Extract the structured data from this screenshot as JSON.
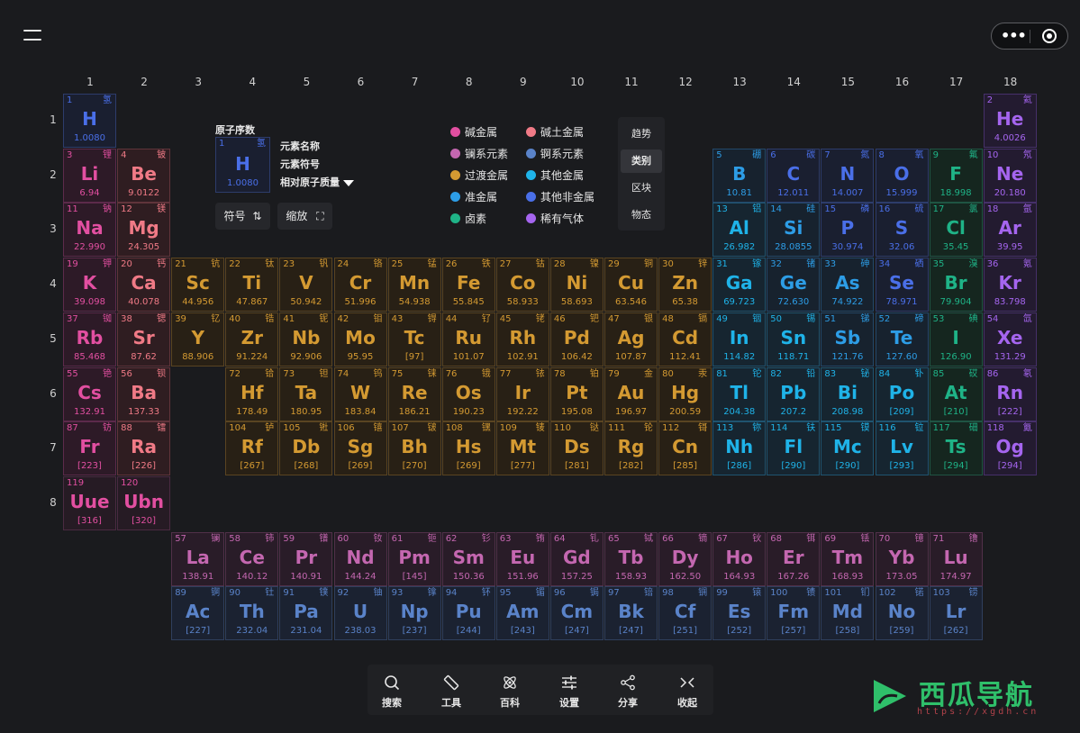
{
  "group_numbers": [
    "1",
    "2",
    "3",
    "4",
    "5",
    "6",
    "7",
    "8",
    "9",
    "10",
    "11",
    "12",
    "13",
    "14",
    "15",
    "16",
    "17",
    "18"
  ],
  "period_numbers": [
    "1",
    "2",
    "3",
    "4",
    "5",
    "6",
    "7",
    "8"
  ],
  "legend": {
    "atomic_number_label": "原子序数",
    "name_label": "元素名称",
    "symbol_label": "元素符号",
    "mass_label": "相对原子质量",
    "sample": {
      "n": "1",
      "cn": "氢",
      "s": "H",
      "m": "1.0080"
    }
  },
  "buttons": {
    "symbol_sort": "符号",
    "zoom": "缩放"
  },
  "categories": [
    {
      "key": "alkali",
      "label": "碱金属",
      "color": "#e24fa1"
    },
    {
      "key": "alkaline",
      "label": "碱土金属",
      "color": "#f07a86"
    },
    {
      "key": "lanth",
      "label": "镧系元素",
      "color": "#c467b0"
    },
    {
      "key": "actin",
      "label": "锕系元素",
      "color": "#5a83c9"
    },
    {
      "key": "trans",
      "label": "过渡金属",
      "color": "#d49a32"
    },
    {
      "key": "post",
      "label": "其他金属",
      "color": "#1fb3e8"
    },
    {
      "key": "metalloid",
      "label": "准金属",
      "color": "#2d9de6"
    },
    {
      "key": "nonmetal",
      "label": "其他非金属",
      "color": "#4a6fe8"
    },
    {
      "key": "halogen",
      "label": "卤素",
      "color": "#1fb387"
    },
    {
      "key": "noble",
      "label": "稀有气体",
      "color": "#a565ef"
    }
  ],
  "view_modes": [
    {
      "label": "趋势",
      "active": false
    },
    {
      "label": "类别",
      "active": true
    },
    {
      "label": "区块",
      "active": false
    },
    {
      "label": "物态",
      "active": false
    }
  ],
  "bottom_bar": [
    {
      "label": "搜索",
      "icon": "search-icon"
    },
    {
      "label": "工具",
      "icon": "ruler-icon"
    },
    {
      "label": "百科",
      "icon": "atom-icon"
    },
    {
      "label": "设置",
      "icon": "sliders-icon"
    },
    {
      "label": "分享",
      "icon": "share-icon"
    },
    {
      "label": "收起",
      "icon": "collapse-icon"
    }
  ],
  "logo": {
    "text": "西瓜导航",
    "url": "https://xgdh.cn"
  },
  "elements": [
    {
      "n": "1",
      "s": "H",
      "cn": "氢",
      "m": "1.0080",
      "c": "nonmetal",
      "col": 1,
      "row": 1
    },
    {
      "n": "2",
      "s": "He",
      "cn": "氦",
      "m": "4.0026",
      "c": "noble",
      "col": 18,
      "row": 1
    },
    {
      "n": "3",
      "s": "Li",
      "cn": "锂",
      "m": "6.94",
      "c": "alkali",
      "col": 1,
      "row": 2
    },
    {
      "n": "4",
      "s": "Be",
      "cn": "铍",
      "m": "9.0122",
      "c": "alkaline",
      "col": 2,
      "row": 2
    },
    {
      "n": "5",
      "s": "B",
      "cn": "硼",
      "m": "10.81",
      "c": "metalloid",
      "col": 13,
      "row": 2
    },
    {
      "n": "6",
      "s": "C",
      "cn": "碳",
      "m": "12.011",
      "c": "nonmetal",
      "col": 14,
      "row": 2
    },
    {
      "n": "7",
      "s": "N",
      "cn": "氮",
      "m": "14.007",
      "c": "nonmetal",
      "col": 15,
      "row": 2
    },
    {
      "n": "8",
      "s": "O",
      "cn": "氧",
      "m": "15.999",
      "c": "nonmetal",
      "col": 16,
      "row": 2
    },
    {
      "n": "9",
      "s": "F",
      "cn": "氟",
      "m": "18.998",
      "c": "halogen",
      "col": 17,
      "row": 2
    },
    {
      "n": "10",
      "s": "Ne",
      "cn": "氖",
      "m": "20.180",
      "c": "noble",
      "col": 18,
      "row": 2
    },
    {
      "n": "11",
      "s": "Na",
      "cn": "钠",
      "m": "22.990",
      "c": "alkali",
      "col": 1,
      "row": 3
    },
    {
      "n": "12",
      "s": "Mg",
      "cn": "镁",
      "m": "24.305",
      "c": "alkaline",
      "col": 2,
      "row": 3
    },
    {
      "n": "13",
      "s": "Al",
      "cn": "铝",
      "m": "26.982",
      "c": "post",
      "col": 13,
      "row": 3
    },
    {
      "n": "14",
      "s": "Si",
      "cn": "硅",
      "m": "28.0855",
      "c": "metalloid",
      "col": 14,
      "row": 3
    },
    {
      "n": "15",
      "s": "P",
      "cn": "磷",
      "m": "30.974",
      "c": "nonmetal",
      "col": 15,
      "row": 3
    },
    {
      "n": "16",
      "s": "S",
      "cn": "硫",
      "m": "32.06",
      "c": "nonmetal",
      "col": 16,
      "row": 3
    },
    {
      "n": "17",
      "s": "Cl",
      "cn": "氯",
      "m": "35.45",
      "c": "halogen",
      "col": 17,
      "row": 3
    },
    {
      "n": "18",
      "s": "Ar",
      "cn": "氩",
      "m": "39.95",
      "c": "noble",
      "col": 18,
      "row": 3
    },
    {
      "n": "19",
      "s": "K",
      "cn": "钾",
      "m": "39.098",
      "c": "alkali",
      "col": 1,
      "row": 4
    },
    {
      "n": "20",
      "s": "Ca",
      "cn": "钙",
      "m": "40.078",
      "c": "alkaline",
      "col": 2,
      "row": 4
    },
    {
      "n": "21",
      "s": "Sc",
      "cn": "钪",
      "m": "44.956",
      "c": "trans",
      "col": 3,
      "row": 4
    },
    {
      "n": "22",
      "s": "Ti",
      "cn": "钛",
      "m": "47.867",
      "c": "trans",
      "col": 4,
      "row": 4
    },
    {
      "n": "23",
      "s": "V",
      "cn": "钒",
      "m": "50.942",
      "c": "trans",
      "col": 5,
      "row": 4
    },
    {
      "n": "24",
      "s": "Cr",
      "cn": "铬",
      "m": "51.996",
      "c": "trans",
      "col": 6,
      "row": 4
    },
    {
      "n": "25",
      "s": "Mn",
      "cn": "锰",
      "m": "54.938",
      "c": "trans",
      "col": 7,
      "row": 4
    },
    {
      "n": "26",
      "s": "Fe",
      "cn": "铁",
      "m": "55.845",
      "c": "trans",
      "col": 8,
      "row": 4
    },
    {
      "n": "27",
      "s": "Co",
      "cn": "钴",
      "m": "58.933",
      "c": "trans",
      "col": 9,
      "row": 4
    },
    {
      "n": "28",
      "s": "Ni",
      "cn": "镍",
      "m": "58.693",
      "c": "trans",
      "col": 10,
      "row": 4
    },
    {
      "n": "29",
      "s": "Cu",
      "cn": "铜",
      "m": "63.546",
      "c": "trans",
      "col": 11,
      "row": 4
    },
    {
      "n": "30",
      "s": "Zn",
      "cn": "锌",
      "m": "65.38",
      "c": "trans",
      "col": 12,
      "row": 4
    },
    {
      "n": "31",
      "s": "Ga",
      "cn": "镓",
      "m": "69.723",
      "c": "post",
      "col": 13,
      "row": 4
    },
    {
      "n": "32",
      "s": "Ge",
      "cn": "锗",
      "m": "72.630",
      "c": "metalloid",
      "col": 14,
      "row": 4
    },
    {
      "n": "33",
      "s": "As",
      "cn": "砷",
      "m": "74.922",
      "c": "metalloid",
      "col": 15,
      "row": 4
    },
    {
      "n": "34",
      "s": "Se",
      "cn": "硒",
      "m": "78.971",
      "c": "nonmetal",
      "col": 16,
      "row": 4
    },
    {
      "n": "35",
      "s": "Br",
      "cn": "溴",
      "m": "79.904",
      "c": "halogen",
      "col": 17,
      "row": 4
    },
    {
      "n": "36",
      "s": "Kr",
      "cn": "氪",
      "m": "83.798",
      "c": "noble",
      "col": 18,
      "row": 4
    },
    {
      "n": "37",
      "s": "Rb",
      "cn": "铷",
      "m": "85.468",
      "c": "alkali",
      "col": 1,
      "row": 5
    },
    {
      "n": "38",
      "s": "Sr",
      "cn": "锶",
      "m": "87.62",
      "c": "alkaline",
      "col": 2,
      "row": 5
    },
    {
      "n": "39",
      "s": "Y",
      "cn": "钇",
      "m": "88.906",
      "c": "trans",
      "col": 3,
      "row": 5
    },
    {
      "n": "40",
      "s": "Zr",
      "cn": "锆",
      "m": "91.224",
      "c": "trans",
      "col": 4,
      "row": 5
    },
    {
      "n": "41",
      "s": "Nb",
      "cn": "铌",
      "m": "92.906",
      "c": "trans",
      "col": 5,
      "row": 5
    },
    {
      "n": "42",
      "s": "Mo",
      "cn": "钼",
      "m": "95.95",
      "c": "trans",
      "col": 6,
      "row": 5
    },
    {
      "n": "43",
      "s": "Tc",
      "cn": "锝",
      "m": "[97]",
      "c": "trans",
      "col": 7,
      "row": 5
    },
    {
      "n": "44",
      "s": "Ru",
      "cn": "钌",
      "m": "101.07",
      "c": "trans",
      "col": 8,
      "row": 5
    },
    {
      "n": "45",
      "s": "Rh",
      "cn": "铑",
      "m": "102.91",
      "c": "trans",
      "col": 9,
      "row": 5
    },
    {
      "n": "46",
      "s": "Pd",
      "cn": "钯",
      "m": "106.42",
      "c": "trans",
      "col": 10,
      "row": 5
    },
    {
      "n": "47",
      "s": "Ag",
      "cn": "银",
      "m": "107.87",
      "c": "trans",
      "col": 11,
      "row": 5
    },
    {
      "n": "48",
      "s": "Cd",
      "cn": "镉",
      "m": "112.41",
      "c": "trans",
      "col": 12,
      "row": 5
    },
    {
      "n": "49",
      "s": "In",
      "cn": "铟",
      "m": "114.82",
      "c": "post",
      "col": 13,
      "row": 5
    },
    {
      "n": "50",
      "s": "Sn",
      "cn": "锡",
      "m": "118.71",
      "c": "post",
      "col": 14,
      "row": 5
    },
    {
      "n": "51",
      "s": "Sb",
      "cn": "锑",
      "m": "121.76",
      "c": "metalloid",
      "col": 15,
      "row": 5
    },
    {
      "n": "52",
      "s": "Te",
      "cn": "碲",
      "m": "127.60",
      "c": "metalloid",
      "col": 16,
      "row": 5
    },
    {
      "n": "53",
      "s": "I",
      "cn": "碘",
      "m": "126.90",
      "c": "halogen",
      "col": 17,
      "row": 5
    },
    {
      "n": "54",
      "s": "Xe",
      "cn": "氙",
      "m": "131.29",
      "c": "noble",
      "col": 18,
      "row": 5
    },
    {
      "n": "55",
      "s": "Cs",
      "cn": "铯",
      "m": "132.91",
      "c": "alkali",
      "col": 1,
      "row": 6
    },
    {
      "n": "56",
      "s": "Ba",
      "cn": "钡",
      "m": "137.33",
      "c": "alkaline",
      "col": 2,
      "row": 6
    },
    {
      "n": "72",
      "s": "Hf",
      "cn": "铪",
      "m": "178.49",
      "c": "trans",
      "col": 4,
      "row": 6
    },
    {
      "n": "73",
      "s": "Ta",
      "cn": "钽",
      "m": "180.95",
      "c": "trans",
      "col": 5,
      "row": 6
    },
    {
      "n": "74",
      "s": "W",
      "cn": "钨",
      "m": "183.84",
      "c": "trans",
      "col": 6,
      "row": 6
    },
    {
      "n": "75",
      "s": "Re",
      "cn": "铼",
      "m": "186.21",
      "c": "trans",
      "col": 7,
      "row": 6
    },
    {
      "n": "76",
      "s": "Os",
      "cn": "锇",
      "m": "190.23",
      "c": "trans",
      "col": 8,
      "row": 6
    },
    {
      "n": "77",
      "s": "Ir",
      "cn": "铱",
      "m": "192.22",
      "c": "trans",
      "col": 9,
      "row": 6
    },
    {
      "n": "78",
      "s": "Pt",
      "cn": "铂",
      "m": "195.08",
      "c": "trans",
      "col": 10,
      "row": 6
    },
    {
      "n": "79",
      "s": "Au",
      "cn": "金",
      "m": "196.97",
      "c": "trans",
      "col": 11,
      "row": 6
    },
    {
      "n": "80",
      "s": "Hg",
      "cn": "汞",
      "m": "200.59",
      "c": "trans",
      "col": 12,
      "row": 6
    },
    {
      "n": "81",
      "s": "Tl",
      "cn": "铊",
      "m": "204.38",
      "c": "post",
      "col": 13,
      "row": 6
    },
    {
      "n": "82",
      "s": "Pb",
      "cn": "铅",
      "m": "207.2",
      "c": "post",
      "col": 14,
      "row": 6
    },
    {
      "n": "83",
      "s": "Bi",
      "cn": "铋",
      "m": "208.98",
      "c": "post",
      "col": 15,
      "row": 6
    },
    {
      "n": "84",
      "s": "Po",
      "cn": "钋",
      "m": "[209]",
      "c": "post",
      "col": 16,
      "row": 6
    },
    {
      "n": "85",
      "s": "At",
      "cn": "砹",
      "m": "[210]",
      "c": "halogen",
      "col": 17,
      "row": 6
    },
    {
      "n": "86",
      "s": "Rn",
      "cn": "氡",
      "m": "[222]",
      "c": "noble",
      "col": 18,
      "row": 6
    },
    {
      "n": "87",
      "s": "Fr",
      "cn": "钫",
      "m": "[223]",
      "c": "alkali",
      "col": 1,
      "row": 7
    },
    {
      "n": "88",
      "s": "Ra",
      "cn": "镭",
      "m": "[226]",
      "c": "alkaline",
      "col": 2,
      "row": 7
    },
    {
      "n": "104",
      "s": "Rf",
      "cn": "𬬻",
      "m": "[267]",
      "c": "trans",
      "col": 4,
      "row": 7
    },
    {
      "n": "105",
      "s": "Db",
      "cn": "𬭊",
      "m": "[268]",
      "c": "trans",
      "col": 5,
      "row": 7
    },
    {
      "n": "106",
      "s": "Sg",
      "cn": "𬭳",
      "m": "[269]",
      "c": "trans",
      "col": 6,
      "row": 7
    },
    {
      "n": "107",
      "s": "Bh",
      "cn": "𬭛",
      "m": "[270]",
      "c": "trans",
      "col": 7,
      "row": 7
    },
    {
      "n": "108",
      "s": "Hs",
      "cn": "𬭶",
      "m": "[269]",
      "c": "trans",
      "col": 8,
      "row": 7
    },
    {
      "n": "109",
      "s": "Mt",
      "cn": "鿏",
      "m": "[277]",
      "c": "trans",
      "col": 9,
      "row": 7
    },
    {
      "n": "110",
      "s": "Ds",
      "cn": "𫟼",
      "m": "[281]",
      "c": "trans",
      "col": 10,
      "row": 7
    },
    {
      "n": "111",
      "s": "Rg",
      "cn": "𬬭",
      "m": "[282]",
      "c": "trans",
      "col": 11,
      "row": 7
    },
    {
      "n": "112",
      "s": "Cn",
      "cn": "鿔",
      "m": "[285]",
      "c": "trans",
      "col": 12,
      "row": 7
    },
    {
      "n": "113",
      "s": "Nh",
      "cn": "鿭",
      "m": "[286]",
      "c": "post",
      "col": 13,
      "row": 7
    },
    {
      "n": "114",
      "s": "Fl",
      "cn": "𫓧",
      "m": "[290]",
      "c": "post",
      "col": 14,
      "row": 7
    },
    {
      "n": "115",
      "s": "Mc",
      "cn": "镆",
      "m": "[290]",
      "c": "post",
      "col": 15,
      "row": 7
    },
    {
      "n": "116",
      "s": "Lv",
      "cn": "𫟷",
      "m": "[293]",
      "c": "post",
      "col": 16,
      "row": 7
    },
    {
      "n": "117",
      "s": "Ts",
      "cn": "鿬",
      "m": "[294]",
      "c": "halogen",
      "col": 17,
      "row": 7
    },
    {
      "n": "118",
      "s": "Og",
      "cn": "鿫",
      "m": "[294]",
      "c": "noble",
      "col": 18,
      "row": 7
    },
    {
      "n": "119",
      "s": "Uue",
      "cn": "",
      "m": "[316]",
      "c": "unknown",
      "col": 1,
      "row": 8
    },
    {
      "n": "120",
      "s": "Ubn",
      "cn": "",
      "m": "[320]",
      "c": "unknown",
      "col": 2,
      "row": 8
    },
    {
      "n": "57",
      "s": "La",
      "cn": "镧",
      "m": "138.91",
      "c": "lanth",
      "col": 3,
      "row": 9
    },
    {
      "n": "58",
      "s": "Ce",
      "cn": "铈",
      "m": "140.12",
      "c": "lanth",
      "col": 4,
      "row": 9
    },
    {
      "n": "59",
      "s": "Pr",
      "cn": "镨",
      "m": "140.91",
      "c": "lanth",
      "col": 5,
      "row": 9
    },
    {
      "n": "60",
      "s": "Nd",
      "cn": "钕",
      "m": "144.24",
      "c": "lanth",
      "col": 6,
      "row": 9
    },
    {
      "n": "61",
      "s": "Pm",
      "cn": "钷",
      "m": "[145]",
      "c": "lanth",
      "col": 7,
      "row": 9
    },
    {
      "n": "62",
      "s": "Sm",
      "cn": "钐",
      "m": "150.36",
      "c": "lanth",
      "col": 8,
      "row": 9
    },
    {
      "n": "63",
      "s": "Eu",
      "cn": "铕",
      "m": "151.96",
      "c": "lanth",
      "col": 9,
      "row": 9
    },
    {
      "n": "64",
      "s": "Gd",
      "cn": "钆",
      "m": "157.25",
      "c": "lanth",
      "col": 10,
      "row": 9
    },
    {
      "n": "65",
      "s": "Tb",
      "cn": "铽",
      "m": "158.93",
      "c": "lanth",
      "col": 11,
      "row": 9
    },
    {
      "n": "66",
      "s": "Dy",
      "cn": "镝",
      "m": "162.50",
      "c": "lanth",
      "col": 12,
      "row": 9
    },
    {
      "n": "67",
      "s": "Ho",
      "cn": "钬",
      "m": "164.93",
      "c": "lanth",
      "col": 13,
      "row": 9
    },
    {
      "n": "68",
      "s": "Er",
      "cn": "铒",
      "m": "167.26",
      "c": "lanth",
      "col": 14,
      "row": 9
    },
    {
      "n": "69",
      "s": "Tm",
      "cn": "铥",
      "m": "168.93",
      "c": "lanth",
      "col": 15,
      "row": 9
    },
    {
      "n": "70",
      "s": "Yb",
      "cn": "镱",
      "m": "173.05",
      "c": "lanth",
      "col": 16,
      "row": 9
    },
    {
      "n": "71",
      "s": "Lu",
      "cn": "镥",
      "m": "174.97",
      "c": "lanth",
      "col": 17,
      "row": 9
    },
    {
      "n": "89",
      "s": "Ac",
      "cn": "锕",
      "m": "[227]",
      "c": "actin",
      "col": 3,
      "row": 10
    },
    {
      "n": "90",
      "s": "Th",
      "cn": "钍",
      "m": "232.04",
      "c": "actin",
      "col": 4,
      "row": 10
    },
    {
      "n": "91",
      "s": "Pa",
      "cn": "镤",
      "m": "231.04",
      "c": "actin",
      "col": 5,
      "row": 10
    },
    {
      "n": "92",
      "s": "U",
      "cn": "铀",
      "m": "238.03",
      "c": "actin",
      "col": 6,
      "row": 10
    },
    {
      "n": "93",
      "s": "Np",
      "cn": "镎",
      "m": "[237]",
      "c": "actin",
      "col": 7,
      "row": 10
    },
    {
      "n": "94",
      "s": "Pu",
      "cn": "钚",
      "m": "[244]",
      "c": "actin",
      "col": 8,
      "row": 10
    },
    {
      "n": "95",
      "s": "Am",
      "cn": "镅",
      "m": "[243]",
      "c": "actin",
      "col": 9,
      "row": 10
    },
    {
      "n": "96",
      "s": "Cm",
      "cn": "锔",
      "m": "[247]",
      "c": "actin",
      "col": 10,
      "row": 10
    },
    {
      "n": "97",
      "s": "Bk",
      "cn": "锫",
      "m": "[247]",
      "c": "actin",
      "col": 11,
      "row": 10
    },
    {
      "n": "98",
      "s": "Cf",
      "cn": "锎",
      "m": "[251]",
      "c": "actin",
      "col": 12,
      "row": 10
    },
    {
      "n": "99",
      "s": "Es",
      "cn": "锿",
      "m": "[252]",
      "c": "actin",
      "col": 13,
      "row": 10
    },
    {
      "n": "100",
      "s": "Fm",
      "cn": "镄",
      "m": "[257]",
      "c": "actin",
      "col": 14,
      "row": 10
    },
    {
      "n": "101",
      "s": "Md",
      "cn": "钔",
      "m": "[258]",
      "c": "actin",
      "col": 15,
      "row": 10
    },
    {
      "n": "102",
      "s": "No",
      "cn": "锘",
      "m": "[259]",
      "c": "actin",
      "col": 16,
      "row": 10
    },
    {
      "n": "103",
      "s": "Lr",
      "cn": "铹",
      "m": "[262]",
      "c": "actin",
      "col": 17,
      "row": 10
    }
  ]
}
